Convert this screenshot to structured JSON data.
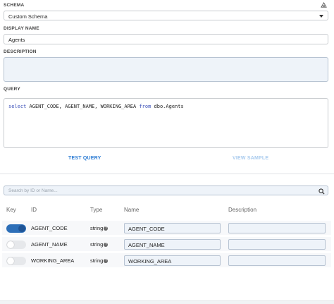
{
  "schema": {
    "label": "SCHEMA",
    "value": "Custom Schema"
  },
  "display_name": {
    "label": "DISPLAY NAME",
    "value": "Agents"
  },
  "description": {
    "label": "DESCRIPTION",
    "value": ""
  },
  "query": {
    "label": "QUERY",
    "keyword_select": "select",
    "columns": " AGENT_CODE, AGENT_NAME, WORKING_AREA ",
    "keyword_from": "from",
    "table": " dbo.Agents"
  },
  "actions": {
    "test_query": "TEST QUERY",
    "view_sample": "VIEW SAMPLE"
  },
  "search": {
    "placeholder": "Search by ID or Name..."
  },
  "table": {
    "headers": {
      "key": "Key",
      "id": "ID",
      "type": "Type",
      "name": "Name",
      "description": "Description"
    },
    "rows": [
      {
        "key": true,
        "id": "AGENT_CODE",
        "type": "string",
        "name": "AGENT_CODE",
        "description": ""
      },
      {
        "key": false,
        "id": "AGENT_NAME",
        "type": "string",
        "name": "AGENT_NAME",
        "description": ""
      },
      {
        "key": false,
        "id": "WORKING_AREA",
        "type": "string",
        "name": "WORKING_AREA",
        "description": ""
      }
    ]
  },
  "colors": {
    "accent": "#2c7cd4",
    "toggle_on": "#2d6fb8",
    "disabled": "#a9cbee",
    "input_bg": "#eef3f9"
  },
  "icons": {
    "top_right": "refresh-icon",
    "search": "search-icon",
    "help": "help-icon"
  }
}
